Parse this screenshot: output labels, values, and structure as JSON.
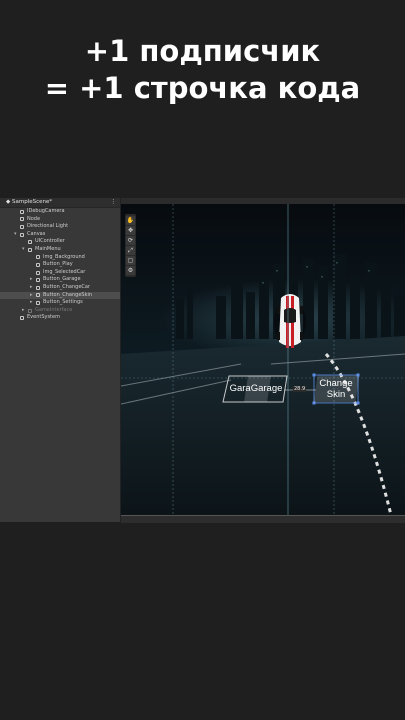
{
  "headline": {
    "line1": "+1 подписчик",
    "line2": "= +1 строчка кода"
  },
  "hierarchy": {
    "scene_name": "SampleScene*",
    "menu_icon": "⋮",
    "items": [
      {
        "label": "IDebugCamera"
      },
      {
        "label": "Node"
      },
      {
        "label": "Directional Light"
      },
      {
        "label": "Canvas"
      },
      {
        "label": "UIController"
      },
      {
        "label": "MainMenu"
      },
      {
        "label": "Img_Background"
      },
      {
        "label": "Button_Play"
      },
      {
        "label": "Img_SelectedCar"
      },
      {
        "label": "Button_Garage"
      },
      {
        "label": "Button_ChangeCar"
      },
      {
        "label": "Button_ChangeSkin"
      },
      {
        "label": "Button_Settings"
      },
      {
        "label": "GameInterface"
      },
      {
        "label": "EventSystem"
      }
    ]
  },
  "scene": {
    "tools": [
      "✋",
      "✥",
      "⟳",
      "⤢",
      "▢",
      "⚙"
    ],
    "button_garage": "GaraGarage",
    "button_skin_line1": "Change",
    "button_skin_line2": "Skin",
    "measure_label": "28.9"
  },
  "colors": {
    "accent_red": "#c81d25",
    "selection_blue": "#5a8ee8"
  }
}
